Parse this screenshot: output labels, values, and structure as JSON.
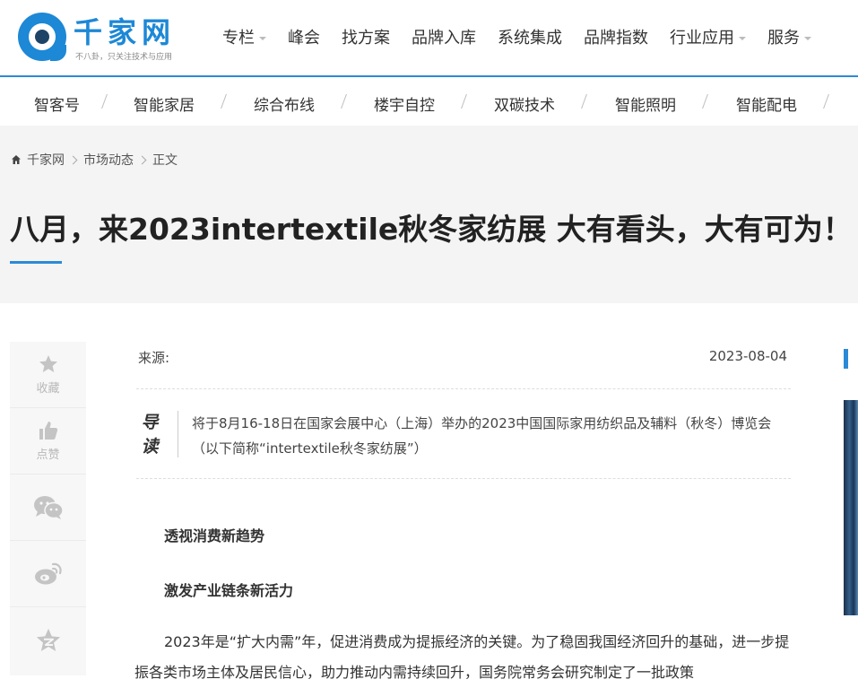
{
  "brand": {
    "name": "千家网",
    "slogan": "不八卦，只关注技术与应用"
  },
  "nav": {
    "items": [
      {
        "label": "专栏",
        "has_dropdown": true
      },
      {
        "label": "峰会",
        "has_dropdown": false
      },
      {
        "label": "找方案",
        "has_dropdown": false
      },
      {
        "label": "品牌入库",
        "has_dropdown": false
      },
      {
        "label": "系统集成",
        "has_dropdown": false
      },
      {
        "label": "品牌指数",
        "has_dropdown": false
      },
      {
        "label": "行业应用",
        "has_dropdown": true
      },
      {
        "label": "服务",
        "has_dropdown": true
      }
    ]
  },
  "subnav": {
    "items": [
      "智客号",
      "智能家居",
      "综合布线",
      "楼宇自控",
      "双碳技术",
      "智能照明",
      "智能配电"
    ]
  },
  "breadcrumb": {
    "home": "千家网",
    "level1": "市场动态",
    "current": "正文"
  },
  "article": {
    "title": "八月，来2023intertextile秋冬家纺展 大有看头，大有可为！",
    "source_label": "来源:",
    "date": "2023-08-04",
    "lead_tag_1": "导",
    "lead_tag_2": "读",
    "lead": "将于8月16-18日在国家会展中心（上海）举办的2023中国国际家用纺织品及辅料（秋冬）博览会（以下简称“intertextile秋冬家纺展”）",
    "subhead_1": "透视消费新趋势",
    "subhead_2": "激发产业链条新活力",
    "para_1": "2023年是“扩大内需”年，促进消费成为提振经济的关键。为了稳固我国经济回升的基础，进一步提振各类市场主体及居民信心，助力推动内需持续回升，国务院常务会研究制定了一批政策"
  },
  "share": {
    "favorite_label": "收藏",
    "like_label": "点赞"
  },
  "colors": {
    "accent": "#2b8ad8",
    "brand": "#1d88d6"
  }
}
